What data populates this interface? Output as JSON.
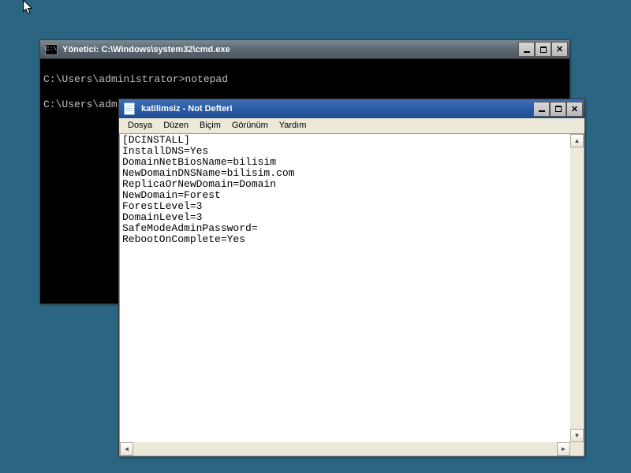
{
  "cmd": {
    "title": "Yönetici: C:\\Windows\\system32\\cmd.exe",
    "icon_text": "C:\\",
    "lines": "\nC:\\Users\\administrator>notepad\n\nC:\\Users\\administrator>"
  },
  "notepad": {
    "title": "katilimsiz - Not Defteri",
    "menu": {
      "file": "Dosya",
      "edit": "Düzen",
      "format": "Biçim",
      "view": "Görünüm",
      "help": "Yardım"
    },
    "content": "[DCINSTALL]\nInstallDNS=Yes\nDomainNetBiosName=bilisim\nNewDomainDNSName=bilisim.com\nReplicaOrNewDomain=Domain\nNewDomain=Forest\nForestLevel=3\nDomainLevel=3\nSafeModeAdminPassword=\nRebootOnComplete=Yes\n"
  }
}
